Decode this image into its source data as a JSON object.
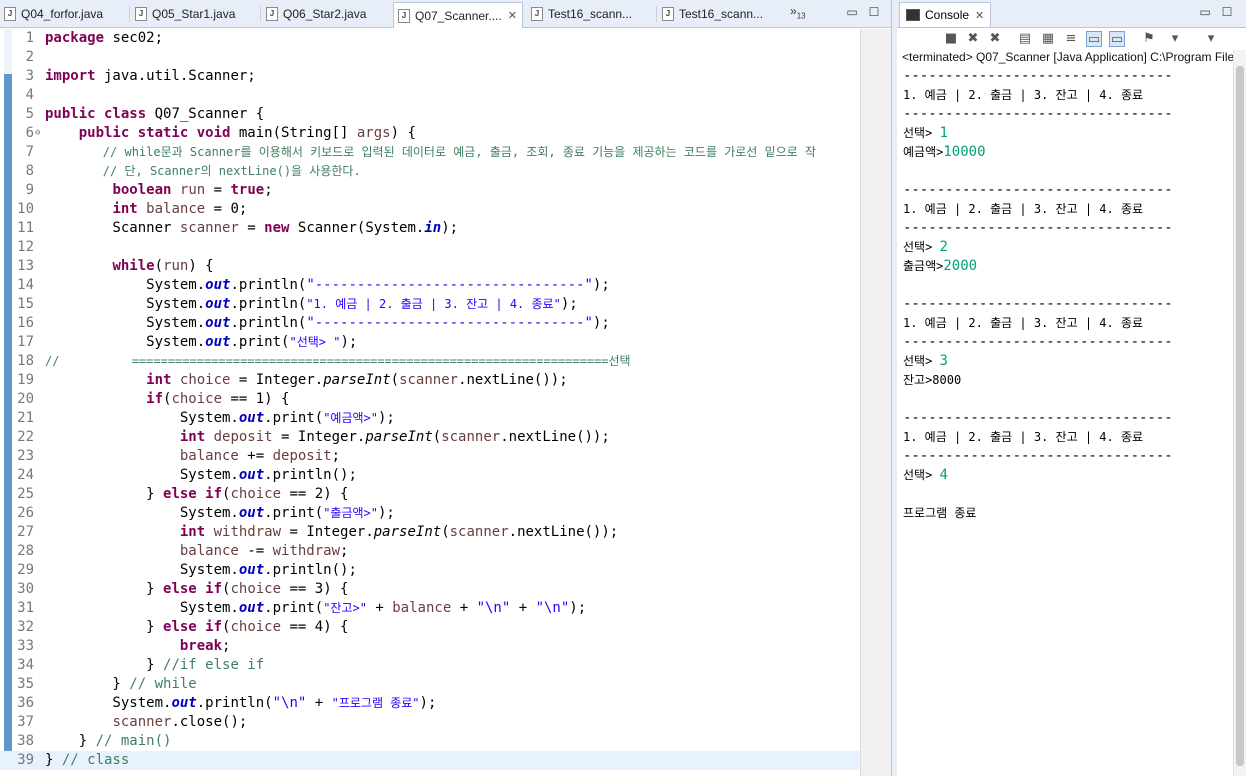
{
  "editor": {
    "tabs": [
      {
        "label": "Q04_forfor.java",
        "active": false
      },
      {
        "label": "Q05_Star1.java",
        "active": false
      },
      {
        "label": "Q06_Star2.java",
        "active": false
      },
      {
        "label": "Q07_Scanner....",
        "active": true
      },
      {
        "label": "Test16_scann...",
        "active": false
      },
      {
        "label": "Test16_scann...",
        "active": false
      }
    ],
    "overflow_label": "»",
    "overflow_count": "13",
    "file_icon_letter": "J",
    "close_glyph": "✕",
    "minimize_glyph": "▭",
    "maximize_glyph": "☐",
    "current_line": 39,
    "code_lines": [
      [
        [
          "kw",
          "package"
        ],
        [
          "",
          " sec02;"
        ]
      ],
      [],
      [
        [
          "kw",
          "import"
        ],
        [
          "",
          " java.util.Scanner;"
        ]
      ],
      [],
      [
        [
          "kw",
          "public class"
        ],
        [
          "",
          " Q07_Scanner {"
        ]
      ],
      [
        [
          "",
          "    "
        ],
        [
          "kw",
          "public static void"
        ],
        [
          "",
          " main(String[] "
        ],
        [
          "var",
          "args"
        ],
        [
          "",
          ") {"
        ]
      ],
      [
        [
          "cm",
          "        // while문과 Scanner를 이용해서 키보드로 입력된 데이터로 예금, 출금, 조회, 종료 기능을 제공하는 코드를 가로선 밑으로 작"
        ]
      ],
      [
        [
          "cm",
          "        // 단, Scanner의 nextLine()을 사용한다."
        ]
      ],
      [
        [
          "",
          "        "
        ],
        [
          "kw",
          "boolean"
        ],
        [
          "",
          " "
        ],
        [
          "var",
          "run"
        ],
        [
          "",
          " = "
        ],
        [
          "kw",
          "true"
        ],
        [
          "",
          ";"
        ]
      ],
      [
        [
          "",
          "        "
        ],
        [
          "kw",
          "int"
        ],
        [
          "",
          " "
        ],
        [
          "var",
          "balance"
        ],
        [
          "",
          " = 0;"
        ]
      ],
      [
        [
          "",
          "        Scanner "
        ],
        [
          "var",
          "scanner"
        ],
        [
          "",
          " = "
        ],
        [
          "kw",
          "new"
        ],
        [
          "",
          " Scanner(System."
        ],
        [
          "fld",
          "in"
        ],
        [
          "",
          ");"
        ]
      ],
      [],
      [
        [
          "",
          "        "
        ],
        [
          "kw",
          "while"
        ],
        [
          "",
          "("
        ],
        [
          "var",
          "run"
        ],
        [
          "",
          ") {"
        ]
      ],
      [
        [
          "",
          "            System."
        ],
        [
          "fld",
          "out"
        ],
        [
          "",
          ".println("
        ],
        [
          "str",
          "\"--------------------------------\""
        ],
        [
          "",
          ");"
        ]
      ],
      [
        [
          "",
          "            System."
        ],
        [
          "fld",
          "out"
        ],
        [
          "",
          ".println("
        ],
        [
          "str",
          "\"1. 예금 | 2. 출금 | 3. 잔고 | 4. 종료\""
        ],
        [
          "",
          ");"
        ]
      ],
      [
        [
          "",
          "            System."
        ],
        [
          "fld",
          "out"
        ],
        [
          "",
          ".println("
        ],
        [
          "str",
          "\"--------------------------------\""
        ],
        [
          "",
          ");"
        ]
      ],
      [
        [
          "",
          "            System."
        ],
        [
          "fld",
          "out"
        ],
        [
          "",
          ".print("
        ],
        [
          "str",
          "\"선택> \""
        ],
        [
          "",
          ");"
        ]
      ],
      [
        [
          "cm",
          "//          ==================================================================선택"
        ]
      ],
      [
        [
          "",
          "            "
        ],
        [
          "kw",
          "int"
        ],
        [
          "",
          " "
        ],
        [
          "var",
          "choice"
        ],
        [
          "",
          " = Integer."
        ],
        [
          "mth",
          "parseInt"
        ],
        [
          "",
          "("
        ],
        [
          "var",
          "scanner"
        ],
        [
          "",
          ".nextLine());"
        ]
      ],
      [
        [
          "",
          "            "
        ],
        [
          "kw",
          "if"
        ],
        [
          "",
          "("
        ],
        [
          "var",
          "choice"
        ],
        [
          "",
          " == 1) {"
        ]
      ],
      [
        [
          "",
          "                System."
        ],
        [
          "fld",
          "out"
        ],
        [
          "",
          ".print("
        ],
        [
          "str",
          "\"예금액>\""
        ],
        [
          "",
          ");"
        ]
      ],
      [
        [
          "",
          "                "
        ],
        [
          "kw",
          "int"
        ],
        [
          "",
          " "
        ],
        [
          "var",
          "deposit"
        ],
        [
          "",
          " = Integer."
        ],
        [
          "mth",
          "parseInt"
        ],
        [
          "",
          "("
        ],
        [
          "var",
          "scanner"
        ],
        [
          "",
          ".nextLine());"
        ]
      ],
      [
        [
          "",
          "                "
        ],
        [
          "var",
          "balance"
        ],
        [
          "",
          " += "
        ],
        [
          "var",
          "deposit"
        ],
        [
          "",
          ";"
        ]
      ],
      [
        [
          "",
          "                System."
        ],
        [
          "fld",
          "out"
        ],
        [
          "",
          ".println();"
        ]
      ],
      [
        [
          "",
          "            } "
        ],
        [
          "kw",
          "else if"
        ],
        [
          "",
          "("
        ],
        [
          "var",
          "choice"
        ],
        [
          "",
          " == 2) {"
        ]
      ],
      [
        [
          "",
          "                System."
        ],
        [
          "fld",
          "out"
        ],
        [
          "",
          ".print("
        ],
        [
          "str",
          "\"출금액>\""
        ],
        [
          "",
          ");"
        ]
      ],
      [
        [
          "",
          "                "
        ],
        [
          "kw",
          "int"
        ],
        [
          "",
          " "
        ],
        [
          "var",
          "withdraw"
        ],
        [
          "",
          " = Integer."
        ],
        [
          "mth",
          "parseInt"
        ],
        [
          "",
          "("
        ],
        [
          "var",
          "scanner"
        ],
        [
          "",
          ".nextLine());"
        ]
      ],
      [
        [
          "",
          "                "
        ],
        [
          "var",
          "balance"
        ],
        [
          "",
          " -= "
        ],
        [
          "var",
          "withdraw"
        ],
        [
          "",
          ";"
        ]
      ],
      [
        [
          "",
          "                System."
        ],
        [
          "fld",
          "out"
        ],
        [
          "",
          ".println();"
        ]
      ],
      [
        [
          "",
          "            } "
        ],
        [
          "kw",
          "else if"
        ],
        [
          "",
          "("
        ],
        [
          "var",
          "choice"
        ],
        [
          "",
          " == 3) {"
        ]
      ],
      [
        [
          "",
          "                System."
        ],
        [
          "fld",
          "out"
        ],
        [
          "",
          ".print("
        ],
        [
          "str",
          "\"잔고>\""
        ],
        [
          "",
          " + "
        ],
        [
          "var",
          "balance"
        ],
        [
          "",
          " + "
        ],
        [
          "str",
          "\"\\n\""
        ],
        [
          "",
          " + "
        ],
        [
          "str",
          "\"\\n\""
        ],
        [
          "",
          ");"
        ]
      ],
      [
        [
          "",
          "            } "
        ],
        [
          "kw",
          "else if"
        ],
        [
          "",
          "("
        ],
        [
          "var",
          "choice"
        ],
        [
          "",
          " == 4) {"
        ]
      ],
      [
        [
          "",
          "                "
        ],
        [
          "kw",
          "break"
        ],
        [
          "",
          ";"
        ]
      ],
      [
        [
          "",
          "            } "
        ],
        [
          "cm",
          "//if else if"
        ]
      ],
      [
        [
          "",
          "        } "
        ],
        [
          "cm",
          "// while"
        ]
      ],
      [
        [
          "",
          "        System."
        ],
        [
          "fld",
          "out"
        ],
        [
          "",
          ".println("
        ],
        [
          "str",
          "\"\\n\""
        ],
        [
          "",
          " + "
        ],
        [
          "str",
          "\"프로그램 종료\""
        ],
        [
          "",
          ");"
        ]
      ],
      [
        [
          "",
          "        "
        ],
        [
          "var",
          "scanner"
        ],
        [
          "",
          ".close();"
        ]
      ],
      [
        [
          "",
          "    } "
        ],
        [
          "cm",
          "// main()"
        ]
      ],
      [
        [
          "",
          "} "
        ],
        [
          "cm",
          "// class"
        ]
      ]
    ]
  },
  "console": {
    "tab_label": "Console",
    "status": "<terminated> Q07_Scanner [Java Application] C:\\Program File",
    "toolbar_icons": [
      "terminate-icon",
      "remove-launch-icon",
      "remove-all-icon",
      "clear-console-icon",
      "scroll-lock-icon",
      "word-wrap-icon",
      "show-on-stdout-icon",
      "show-on-stderr-icon",
      "pin-console-icon",
      "display-console-icon",
      "open-console-icon"
    ],
    "output": [
      [
        [
          "",
          "--------------------------------"
        ]
      ],
      [
        [
          "",
          "1. 예금 | 2. 출금 | 3. 잔고 | 4. 종료"
        ]
      ],
      [
        [
          "",
          "--------------------------------"
        ]
      ],
      [
        [
          "",
          "선택> "
        ],
        [
          "in",
          "1"
        ]
      ],
      [
        [
          "",
          "예금액>"
        ],
        [
          "in",
          "10000"
        ]
      ],
      [],
      [
        [
          "",
          "--------------------------------"
        ]
      ],
      [
        [
          "",
          "1. 예금 | 2. 출금 | 3. 잔고 | 4. 종료"
        ]
      ],
      [
        [
          "",
          "--------------------------------"
        ]
      ],
      [
        [
          "",
          "선택> "
        ],
        [
          "in",
          "2"
        ]
      ],
      [
        [
          "",
          "출금액>"
        ],
        [
          "in",
          "2000"
        ]
      ],
      [],
      [
        [
          "",
          "--------------------------------"
        ]
      ],
      [
        [
          "",
          "1. 예금 | 2. 출금 | 3. 잔고 | 4. 종료"
        ]
      ],
      [
        [
          "",
          "--------------------------------"
        ]
      ],
      [
        [
          "",
          "선택> "
        ],
        [
          "in",
          "3"
        ]
      ],
      [
        [
          "",
          "잔고>8000"
        ]
      ],
      [],
      [
        [
          "",
          "--------------------------------"
        ]
      ],
      [
        [
          "",
          "1. 예금 | 2. 출금 | 3. 잔고 | 4. 종료"
        ]
      ],
      [
        [
          "",
          "--------------------------------"
        ]
      ],
      [
        [
          "",
          "선택> "
        ],
        [
          "in",
          "4"
        ]
      ],
      [],
      [
        [
          "",
          "프로그램 종료"
        ]
      ]
    ]
  }
}
